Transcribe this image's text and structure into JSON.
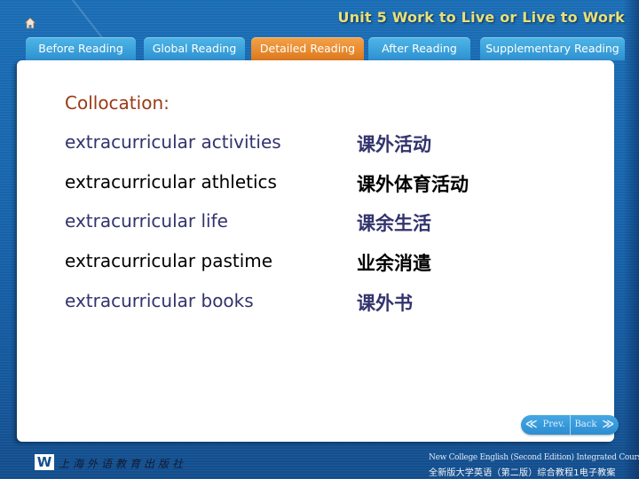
{
  "header": {
    "home_icon": "home-icon",
    "unit_title": "Unit 5  Work to Live or Live to Work"
  },
  "tabs": [
    {
      "label": "Before Reading",
      "active": false
    },
    {
      "label": "Global Reading",
      "active": false
    },
    {
      "label": "Detailed Reading",
      "active": true
    },
    {
      "label": "After Reading",
      "active": false
    },
    {
      "label": "Supplementary Reading",
      "active": false
    }
  ],
  "colors": {
    "active_tab": "#e88a2e",
    "inactive_tab": "#3aa0da",
    "heading": "#9a3a14",
    "odd_row_text": "#33336e",
    "even_row_text": "#000000",
    "unit_title": "#e8e07a"
  },
  "content": {
    "heading": "Collocation:",
    "collocations": [
      {
        "english": "extracurricular activities",
        "chinese": "课外活动"
      },
      {
        "english": "extracurricular athletics",
        "chinese": "课外体育活动"
      },
      {
        "english": "extracurricular life",
        "chinese": "课余生活"
      },
      {
        "english": "extracurricular pastime",
        "chinese": "业余消遣"
      },
      {
        "english": "extracurricular books",
        "chinese": "课外书"
      }
    ]
  },
  "navigation": {
    "prev_label": "Prev.",
    "prev_icon": "double-chevron-left-icon",
    "back_label": "Back",
    "back_icon": "double-chevron-right-icon",
    "prev_glyph": "≪",
    "back_glyph": "≫"
  },
  "footer": {
    "logo_letter": "W",
    "publisher": "上海外语教育出版社",
    "course_en": "New College English (Second Edition) Integrated Course",
    "course_zh": "全新版大学英语（第二版）综合教程1电子教案"
  }
}
